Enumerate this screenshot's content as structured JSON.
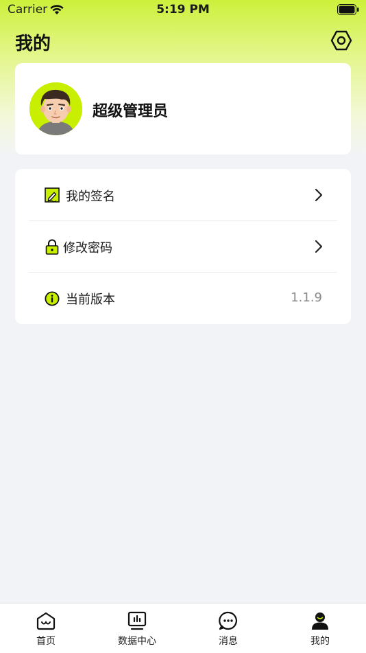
{
  "status_bar": {
    "carrier": "Carrier",
    "time": "5:19 PM"
  },
  "header": {
    "title": "我的",
    "settings_icon": "settings-hexagon-icon"
  },
  "profile": {
    "username": "超级管理员",
    "avatar_icon": "user-avatar-cartoon"
  },
  "menu": {
    "items": [
      {
        "label": "我的签名",
        "icon": "signature-icon",
        "trailing": "chevron-right-icon"
      },
      {
        "label": "修改密码",
        "icon": "lock-icon",
        "trailing": "chevron-right-icon"
      },
      {
        "label": "当前版本",
        "icon": "info-icon",
        "value": "1.1.9"
      }
    ]
  },
  "tab_bar": {
    "tabs": [
      {
        "label": "首页",
        "icon": "home-icon",
        "active": false
      },
      {
        "label": "数据中心",
        "icon": "data-center-icon",
        "active": false
      },
      {
        "label": "消息",
        "icon": "message-icon",
        "active": false
      },
      {
        "label": "我的",
        "icon": "profile-icon",
        "active": true
      }
    ]
  },
  "colors": {
    "accent": "#c8ee00",
    "background": "#f2f3f7",
    "card": "#ffffff"
  }
}
